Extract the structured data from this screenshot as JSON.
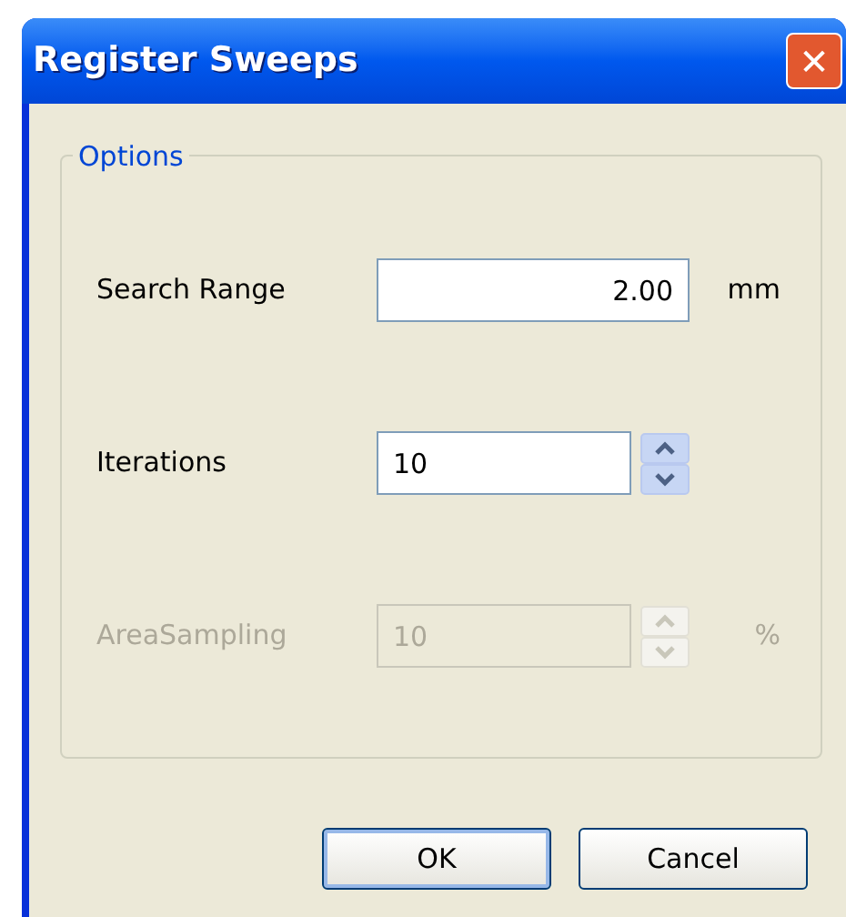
{
  "window": {
    "title": "Register Sweeps",
    "close_label": "✕"
  },
  "group": {
    "title": "Options"
  },
  "fields": [
    {
      "kind": "text",
      "label": "Search Range",
      "value": "2.00",
      "unit": "mm",
      "disabled": false
    },
    {
      "kind": "spinner",
      "label": "Iterations",
      "value": "10",
      "disabled": false
    },
    {
      "kind": "spinner",
      "label": "AreaSampling",
      "value": "10",
      "unit": "%",
      "disabled": true
    }
  ],
  "buttons": [
    {
      "label": "OK",
      "default": true
    },
    {
      "label": "Cancel",
      "default": false
    }
  ]
}
